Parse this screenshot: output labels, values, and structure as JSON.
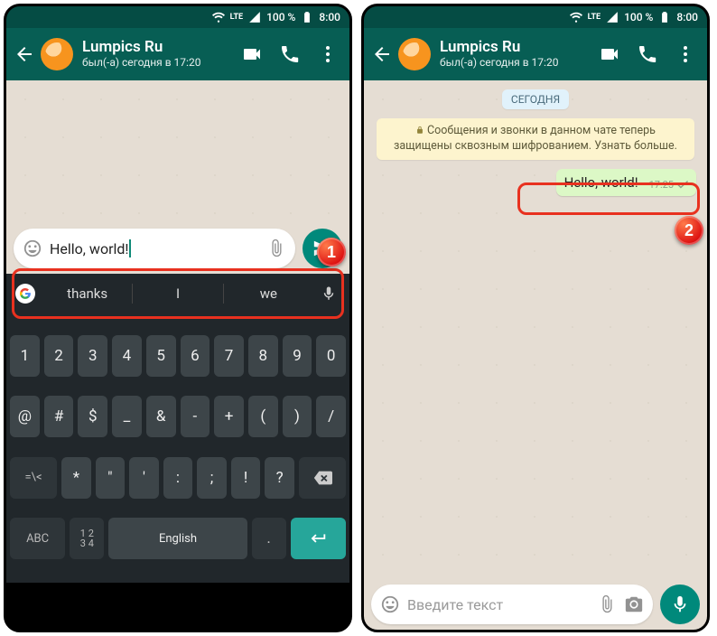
{
  "status": {
    "lte": "LTE",
    "battery": "100 %",
    "time": "8:00"
  },
  "header": {
    "title": "Lumpics Ru",
    "subtitle": "был(-а) сегодня в 17:20"
  },
  "screen1": {
    "input_value": "Hello, world!",
    "suggestions": [
      "thanks",
      "I",
      "we"
    ],
    "kb_row1": [
      "1",
      "2",
      "3",
      "4",
      "5",
      "6",
      "7",
      "8",
      "9",
      "0"
    ],
    "kb_row2": [
      "@",
      "#",
      "$",
      "_",
      "&",
      "-",
      "+",
      "(",
      ")",
      "/"
    ],
    "kb_row3_first": "=\\<",
    "kb_row3": [
      "*",
      "\"",
      "'",
      ":",
      ";",
      "!",
      "?"
    ],
    "kb_row4": {
      "abc": "ABC",
      "nums": "1 2\n3 4",
      "space": "English"
    }
  },
  "screen2": {
    "day": "СЕГОДНЯ",
    "encryption": "Сообщения и звонки в данном чате теперь защищены сквозным шифрованием. Узнать больше.",
    "placeholder": "Введите текст",
    "msg": {
      "text": "Hello, world!",
      "time": "17:25"
    }
  },
  "badges": {
    "one": "1",
    "two": "2"
  }
}
